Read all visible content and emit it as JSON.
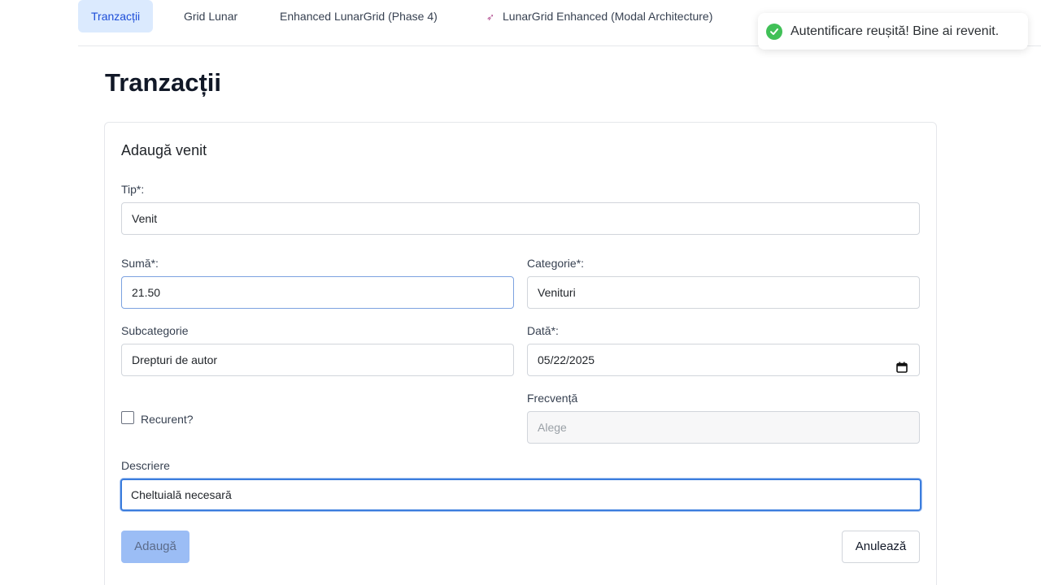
{
  "nav": {
    "tabs": [
      {
        "label": "Tranzacții"
      },
      {
        "label": "Grid Lunar"
      },
      {
        "label": "Enhanced LunarGrid (Phase 4)"
      },
      {
        "label": "LunarGrid Enhanced (Modal Architecture)"
      }
    ]
  },
  "toast": {
    "message": "Autentificare reușită! Bine ai revenit."
  },
  "page": {
    "title": "Tranzacții"
  },
  "form": {
    "title": "Adaugă venit",
    "tip": {
      "label": "Tip*:",
      "value": "Venit"
    },
    "suma": {
      "label": "Sumă*:",
      "value": "21.50"
    },
    "categorie": {
      "label": "Categorie*:",
      "value": "Venituri"
    },
    "subcategorie": {
      "label": "Subcategorie",
      "value": "Drepturi de autor"
    },
    "data": {
      "label": "Dată*:",
      "value": "05/22/2025"
    },
    "recurent": {
      "label": "Recurent?",
      "checked": false
    },
    "frecventa": {
      "label": "Frecvență",
      "placeholder": "Alege"
    },
    "descriere": {
      "label": "Descriere",
      "value": "Cheltuială necesară"
    },
    "submit_label": "Adaugă",
    "cancel_label": "Anulează"
  },
  "colors": {
    "accent": "#3b7ddd",
    "tab_active_bg": "#dbeafe",
    "success": "#40c057"
  }
}
